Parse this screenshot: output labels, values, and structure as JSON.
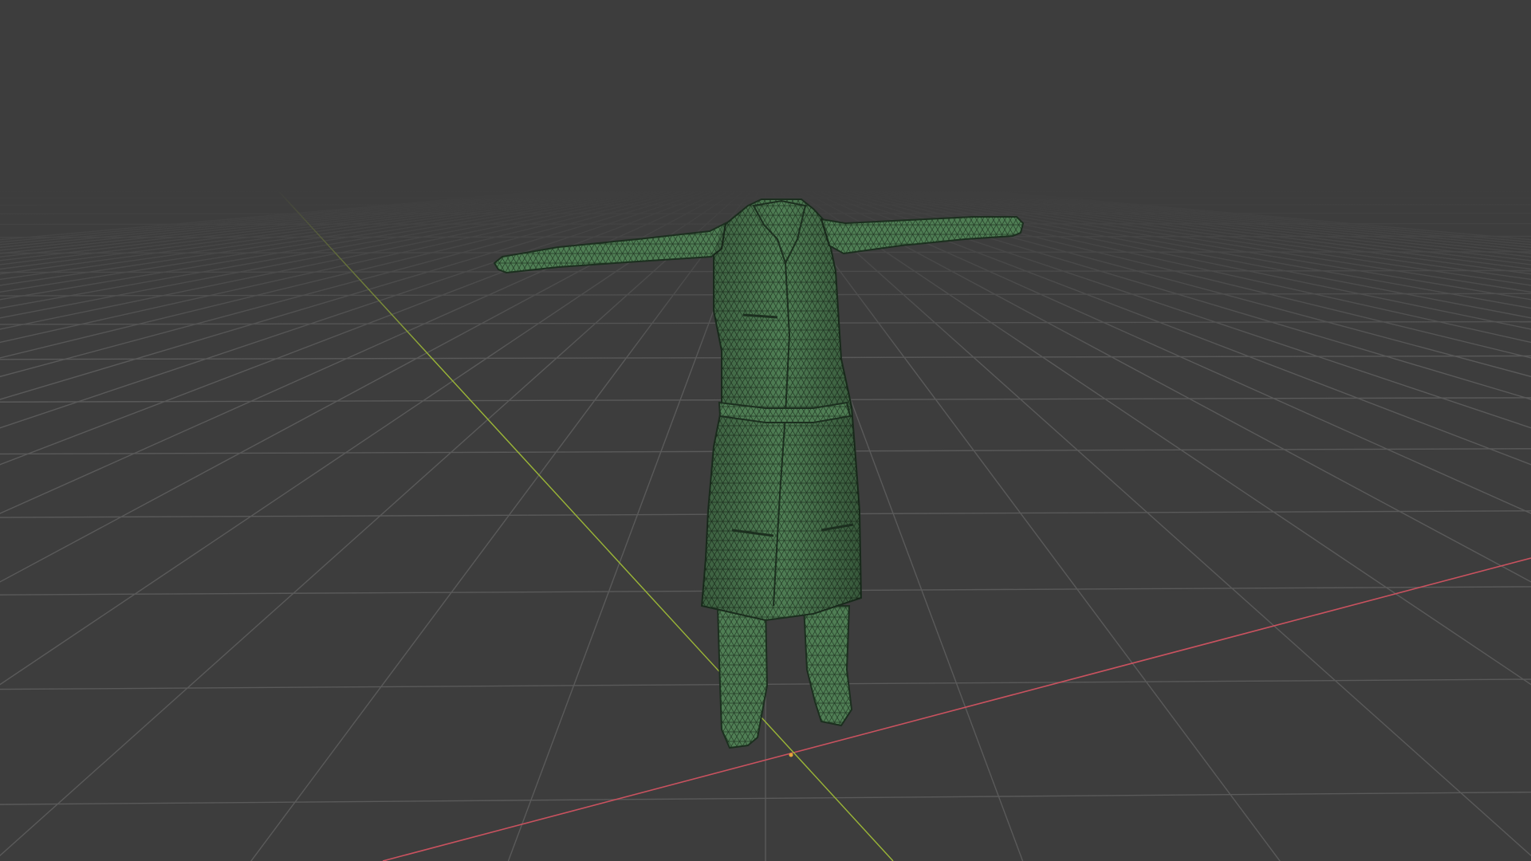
{
  "viewport": {
    "background": "#3d3d3d",
    "grid_line_color": "#595959",
    "x_axis_color": "#c9525f",
    "y_axis_color": "#9bb637"
  },
  "object": {
    "kind": "garment-mesh",
    "description_icon": "coat-with-trousers-icon",
    "base_color": "#4f7e54",
    "wire_color": "#1c2f1f"
  }
}
